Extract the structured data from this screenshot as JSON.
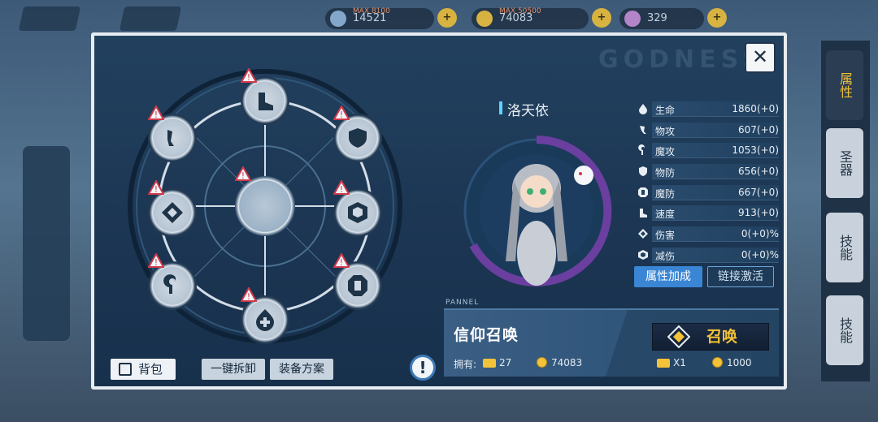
{
  "background": {
    "resources": [
      {
        "name": "resource-1",
        "max_label": "MAX 8100",
        "value": "14521",
        "color": "#8fb5d8"
      },
      {
        "name": "resource-2",
        "max_label": "MAX 50500",
        "value": "74083",
        "color": "#f2c238"
      },
      {
        "name": "resource-3",
        "max_label": "",
        "value": "329",
        "color": "#c78bd6"
      }
    ],
    "side_tabs": [
      "属性",
      "圣器",
      "技能",
      "技能"
    ]
  },
  "panel": {
    "watermark": "GODNESS",
    "close_label": "✕",
    "bag_label": "背包",
    "unequip_all_label": "一键拆卸",
    "equip_plan_label": "装备方案",
    "info_label": "!"
  },
  "character": {
    "name": "洛天依",
    "ring_color": "#6b3fa0"
  },
  "stats": [
    {
      "icon": "drop-icon",
      "label": "生命",
      "value": "1860(+0)"
    },
    {
      "icon": "sword-icon",
      "label": "物攻",
      "value": "607(+0)"
    },
    {
      "icon": "magic-icon",
      "label": "魔攻",
      "value": "1053(+0)"
    },
    {
      "icon": "shield-icon",
      "label": "物防",
      "value": "656(+0)"
    },
    {
      "icon": "magic-shield-icon",
      "label": "魔防",
      "value": "667(+0)"
    },
    {
      "icon": "boot-icon",
      "label": "速度",
      "value": "913(+0)"
    },
    {
      "icon": "damage-icon",
      "label": "伤害",
      "value": "0(+0)%"
    },
    {
      "icon": "reduce-icon",
      "label": "减伤",
      "value": "0(+0)%"
    }
  ],
  "stat_buttons": {
    "attribute_bonus": "属性加成",
    "link_activate": "链接激活"
  },
  "summon": {
    "pannel_tag": "PANNEL",
    "title": "信仰召唤",
    "own_label": "拥有:",
    "tickets_owned": "27",
    "coins_owned": "74083",
    "button_label": "召唤",
    "ticket_cost": "X1",
    "coin_cost": "1000"
  },
  "colors": {
    "accent": "#3a86d4",
    "gold": "#f2c238",
    "panel": "#1b3552"
  }
}
